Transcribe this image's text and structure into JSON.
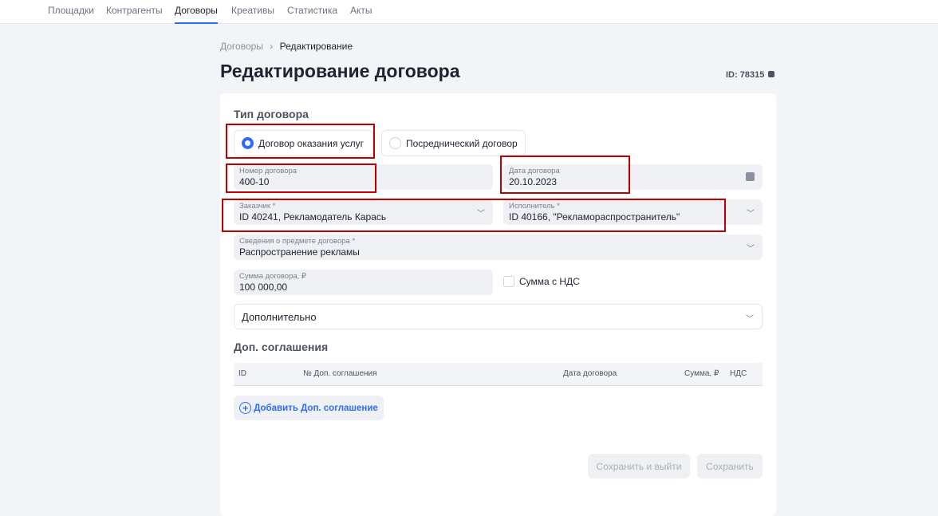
{
  "nav": [
    "Площадки",
    "Контрагенты",
    "Договоры",
    "Креативы",
    "Статистика",
    "Акты"
  ],
  "breadcrumb": {
    "parent": "Договоры",
    "sep": "›",
    "current": "Редактирование"
  },
  "title": "Редактирование договора",
  "id_label": "ID: 78315",
  "type": {
    "heading": "Тип договора",
    "options": [
      "Договор оказания услуг",
      "Посреднический договор"
    ],
    "selected": 0
  },
  "fields": {
    "number": {
      "label": "Номер договора",
      "value": "400-10"
    },
    "date": {
      "label": "Дата договора",
      "value": "20.10.2023"
    },
    "customer": {
      "label": "Заказчик *",
      "value": "ID 40241, Рекламодатель Карась"
    },
    "executor": {
      "label": "Исполнитель *",
      "value": "ID 40166, \"Рекламораспространитель\""
    },
    "subject": {
      "label": "Сведения о предмете договора *",
      "value": "Распространение рекламы"
    },
    "sum": {
      "label": "Сумма договора, ₽",
      "value": "100 000,00"
    }
  },
  "vat_checkbox": {
    "label": "Сумма с НДС",
    "checked": false
  },
  "additional": "Дополнительно",
  "agreements": {
    "heading": "Доп. соглашения",
    "columns": [
      "ID",
      "№ Доп. соглашения",
      "Дата договора",
      "Сумма, ₽",
      "НДС"
    ],
    "add": "Добавить Доп. соглашение"
  },
  "buttons": {
    "save_exit": "Сохранить и выйти",
    "save": "Сохранить"
  }
}
